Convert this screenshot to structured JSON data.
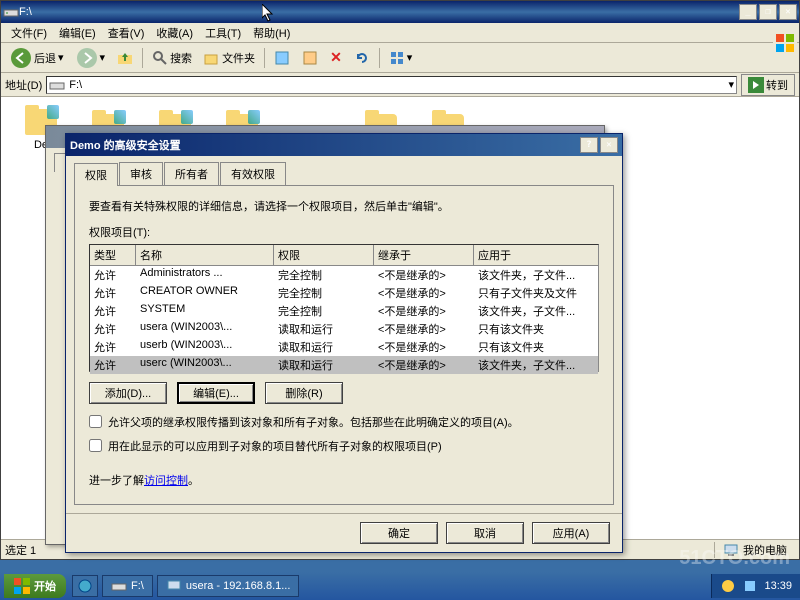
{
  "explorer": {
    "title": "F:\\",
    "menu": [
      "文件(F)",
      "编辑(E)",
      "查看(V)",
      "收藏(A)",
      "工具(T)",
      "帮助(H)"
    ],
    "toolbar": {
      "back": "后退",
      "search": "搜索",
      "folders": "文件夹"
    },
    "address": {
      "label": "地址(D)",
      "value": "F:\\",
      "go": "转到"
    },
    "folder_label": "De",
    "status_left": "选定 1",
    "status_right": "我的电脑"
  },
  "dialog": {
    "title": "Demo 的高级安全设置",
    "tabs": [
      "权限",
      "审核",
      "所有者",
      "有效权限"
    ],
    "instruction": "要查看有关特殊权限的详细信息，请选择一个权限项目，然后单击\"编辑\"。",
    "list_label": "权限项目(T):",
    "columns": [
      "类型",
      "名称",
      "权限",
      "继承于",
      "应用于"
    ],
    "rows": [
      {
        "type": "允许",
        "name": "Administrators ...",
        "perm": "完全控制",
        "inherit": "<不是继承的>",
        "apply": "该文件夹，子文件..."
      },
      {
        "type": "允许",
        "name": "CREATOR OWNER",
        "perm": "完全控制",
        "inherit": "<不是继承的>",
        "apply": "只有子文件夹及文件"
      },
      {
        "type": "允许",
        "name": "SYSTEM",
        "perm": "完全控制",
        "inherit": "<不是继承的>",
        "apply": "该文件夹，子文件..."
      },
      {
        "type": "允许",
        "name": "usera (WIN2003\\...",
        "perm": "读取和运行",
        "inherit": "<不是继承的>",
        "apply": "只有该文件夹"
      },
      {
        "type": "允许",
        "name": "userb (WIN2003\\...",
        "perm": "读取和运行",
        "inherit": "<不是继承的>",
        "apply": "只有该文件夹"
      },
      {
        "type": "允许",
        "name": "userc (WIN2003\\...",
        "perm": "读取和运行",
        "inherit": "<不是继承的>",
        "apply": "该文件夹，子文件..."
      }
    ],
    "buttons": {
      "add": "添加(D)...",
      "edit": "编辑(E)...",
      "remove": "删除(R)"
    },
    "checkbox1": "允许父项的继承权限传播到该对象和所有子对象。包括那些在此明确定义的项目(A)。",
    "checkbox2": "用在此显示的可以应用到子对象的项目替代所有子对象的权限项目(P)",
    "link_prefix": "进一步了解",
    "link_text": "访问控制",
    "link_suffix": "。",
    "footer": {
      "ok": "确定",
      "cancel": "取消",
      "apply": "应用(A)"
    }
  },
  "taskbar": {
    "start": "开始",
    "tasks": [
      "",
      "F:\\",
      "usera - 192.168.8.1..."
    ],
    "time": "13:39"
  },
  "watermark": "51CTO.com"
}
